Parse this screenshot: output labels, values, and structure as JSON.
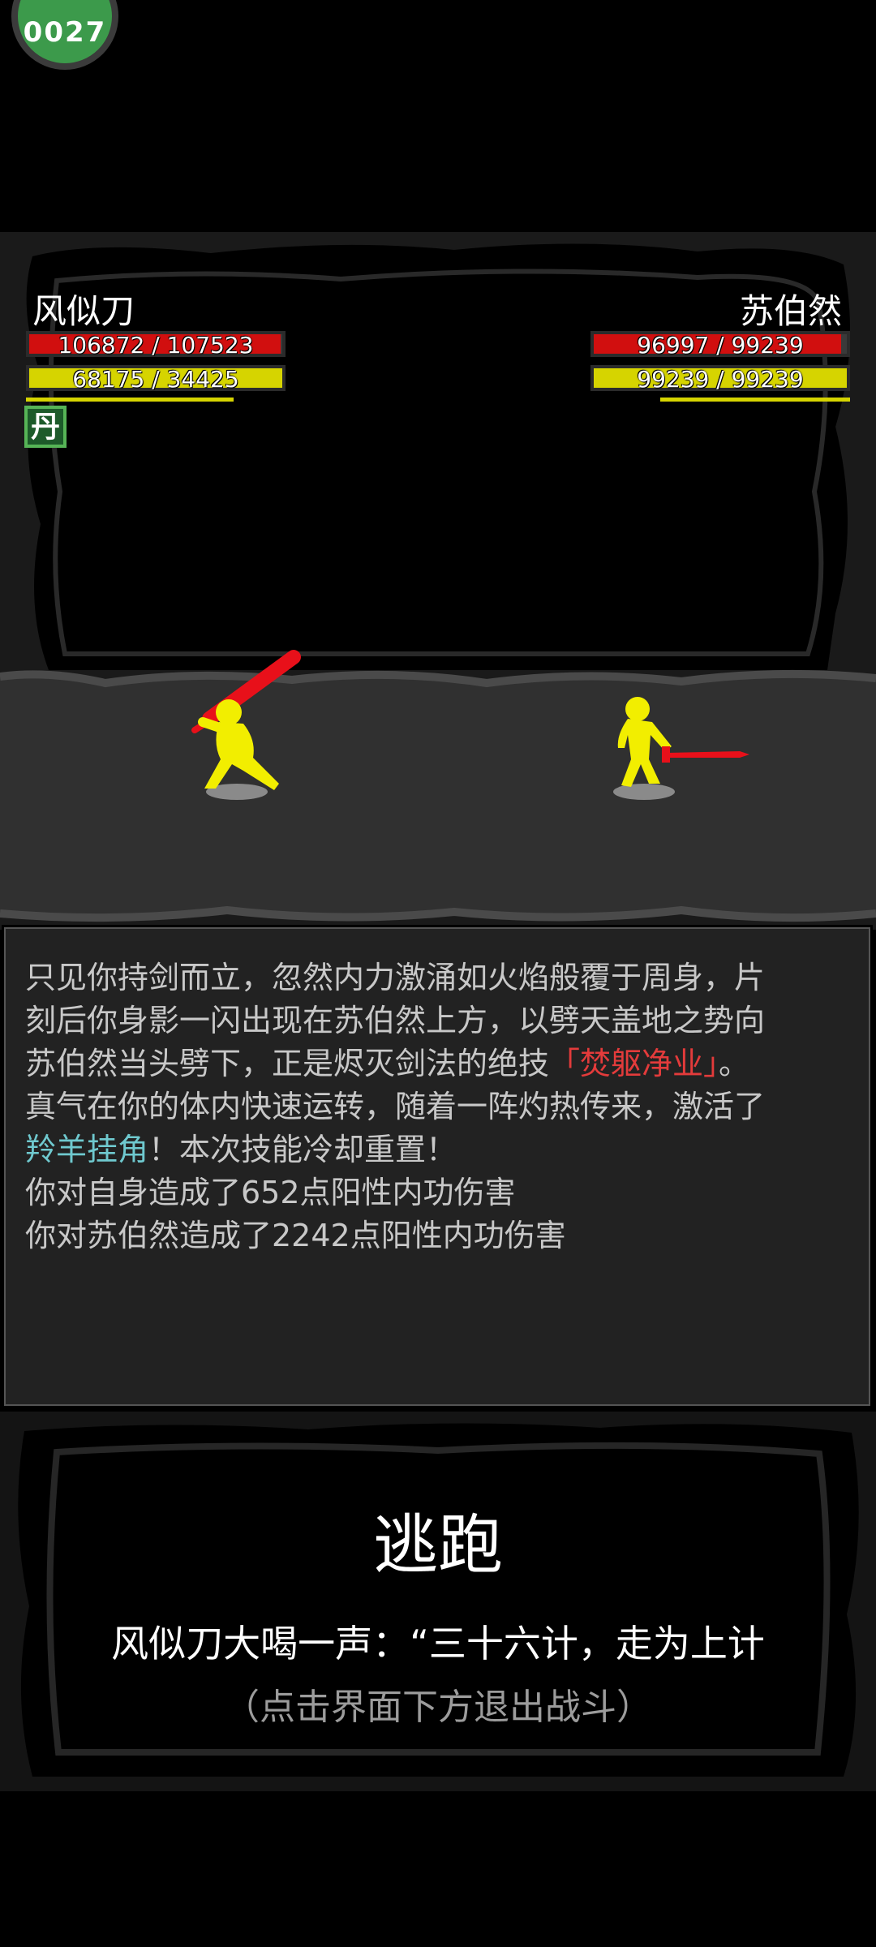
{
  "badge": {
    "label": "0027"
  },
  "player": {
    "name": "风似刀",
    "hp_text": "106872 / 107523",
    "hp_fraction": 0.994,
    "mp_text": "68175 / 34425",
    "mp_fraction": 1.0,
    "cooldown_fraction": 0.8,
    "item_label": "丹"
  },
  "enemy": {
    "name": "苏伯然",
    "hp_text": "96997 / 99239",
    "hp_fraction": 0.977,
    "mp_text": "99239 / 99239",
    "mp_fraction": 1.0,
    "cooldown_fraction": 0.73
  },
  "log": {
    "line1": "只见你持剑而立，忽然内力激涌如火焰般覆于周身，片",
    "line2": "刻后你身影一闪出现在苏伯然上方，以劈天盖地之势向",
    "line3_a": "苏伯然当头劈下，正是烬灭剑法的绝技",
    "line3_skill": "「焚躯净业」",
    "line3_b": "。",
    "line4": "真气在你的体内快速运转，随着一阵灼热传来，激活了",
    "line5_skill": "羚羊挂角",
    "line5_b": "！本次技能冷却重置！",
    "line6": "你对自身造成了652点阳性内功伤害",
    "line7": "你对苏伯然造成了2242点阳性内功伤害"
  },
  "escape": {
    "title": "逃跑",
    "shout": "风似刀大喝一声：“三十六计，走为上计",
    "hint": "（点击界面下方退出战斗）"
  },
  "colors": {
    "hp": "#d10f0f",
    "mp": "#d6d400",
    "fighter": "#f2ee00",
    "blade": "#e8101a",
    "skill_red": "#e33b3b",
    "skill_cyan": "#6fc9cf"
  }
}
